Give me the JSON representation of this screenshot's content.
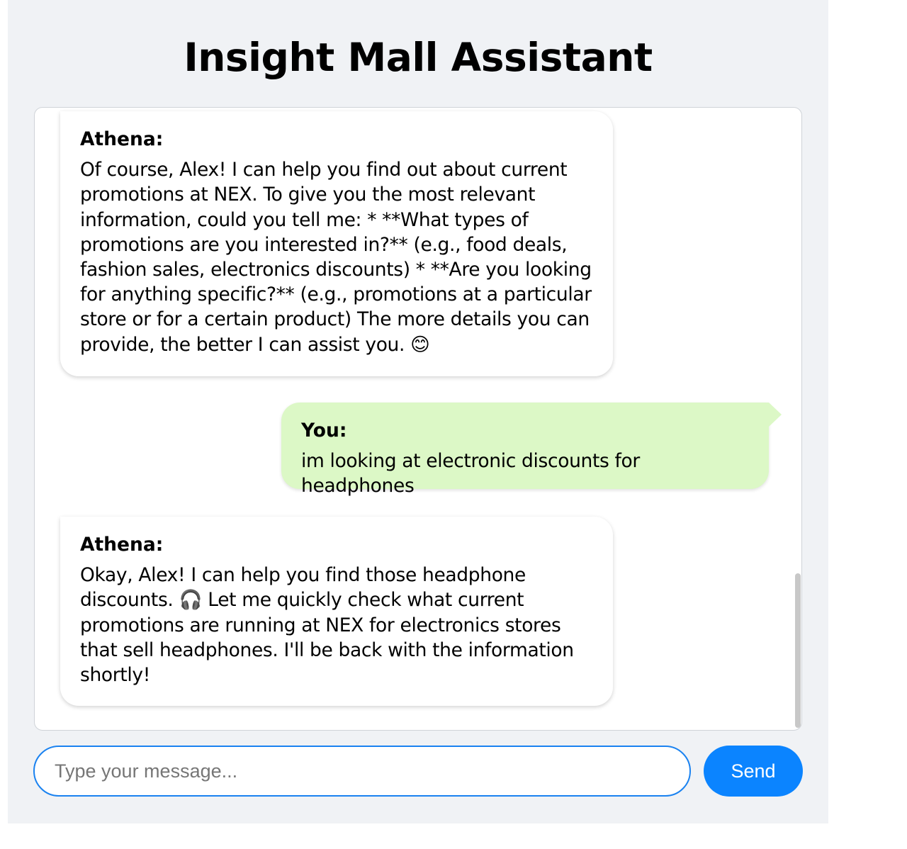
{
  "app": {
    "title": "Insight Mall Assistant"
  },
  "messages": [
    {
      "role": "bot",
      "sender": "Athena:",
      "text": "Of course, Alex! I can help you find out about current promotions at NEX. To give you the most relevant information, could you tell me: * **What types of promotions are you interested in?** (e.g., food deals, fashion sales, electronics discounts) * **Are you looking for anything specific?** (e.g., promotions at a particular store or for a certain product) The more details you can provide, the better I can assist you. 😊"
    },
    {
      "role": "user",
      "sender": "You:",
      "text": "im looking at electronic discounts for headphones"
    },
    {
      "role": "bot",
      "sender": "Athena:",
      "text": "Okay, Alex! I can help you find those headphone discounts. 🎧 Let me quickly check what current promotions are running at NEX for electronics stores that sell headphones. I'll be back with the information shortly!"
    }
  ],
  "composer": {
    "placeholder": "Type your message...",
    "value": "",
    "send_label": "Send"
  },
  "colors": {
    "accent": "#0b84ff",
    "user_bubble": "#dcf8c6",
    "page_background": "#f0f2f5"
  }
}
